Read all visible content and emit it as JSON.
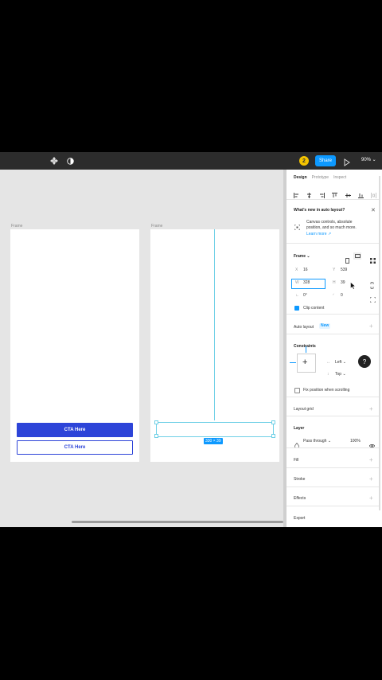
{
  "topbar": {
    "avatar_initial": "2",
    "share_label": "Share",
    "zoom_label": "90%",
    "icons": [
      "component-icon",
      "contrast-icon",
      "play-icon"
    ]
  },
  "canvas": {
    "frame1_label": "Frame",
    "frame2_label": "Frame",
    "cta_primary_label": "CTA Here",
    "cta_secondary_label": "CTA Here",
    "dimension_badge": "330 × 39"
  },
  "panel": {
    "tabs": [
      "Design",
      "Prototype",
      "Inspect"
    ],
    "whats_new_title": "What's new in auto layout?",
    "whats_new_body_1": "Canvas controls, absolute",
    "whats_new_body_2": "position, and so much more.",
    "learn_more": "Learn more ↗",
    "frame_label": "Frame ⌄",
    "x_label": "X",
    "x_value": "16",
    "y_label": "Y",
    "y_value": "539",
    "w_label": "W",
    "w_value": "328",
    "h_label": "H",
    "h_value": "39",
    "rotation_value": "0°",
    "radius_value": "0",
    "clip_content": "Clip content",
    "auto_layout": "Auto layout",
    "new_badge": "New",
    "constraints": "Constraints",
    "constraint_h": "Left",
    "constraint_v": "Top",
    "fix_position": "Fix position when scrolling",
    "layout_grid": "Layout grid",
    "layer": "Layer",
    "pass_through": "Pass through",
    "opacity": "100%",
    "fill": "Fill",
    "stroke": "Stroke",
    "effects": "Effects",
    "export": "Export",
    "help": "?"
  },
  "colors": {
    "accent": "#0d99ff",
    "cta_blue": "#2d44d8",
    "avatar": "#f5c400",
    "topbar": "#2c2c2c",
    "canvas": "#e5e5e5",
    "guide": "#6fd0e6"
  }
}
